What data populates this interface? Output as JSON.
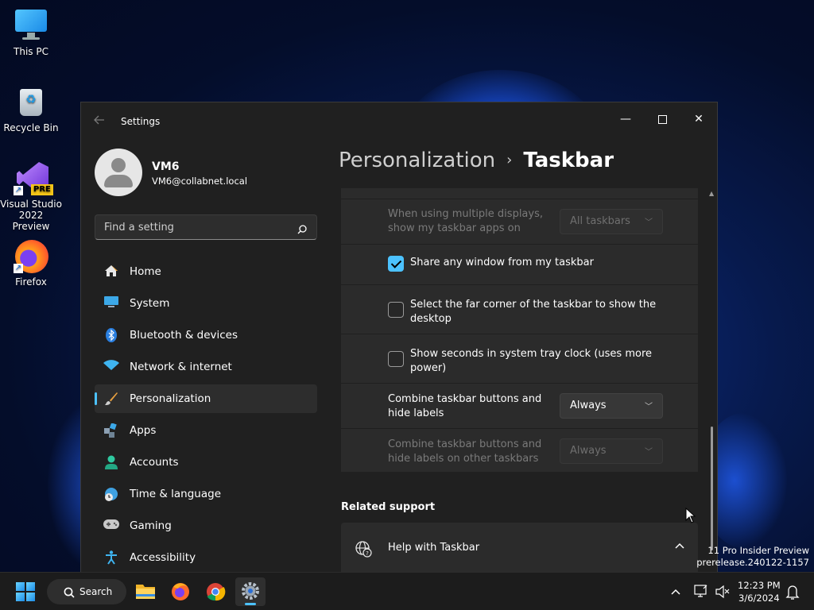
{
  "desktop": {
    "icons": [
      {
        "label": "This PC",
        "icon": "computer-monitor-icon"
      },
      {
        "label": "Recycle Bin",
        "icon": "recycle-bin-icon"
      },
      {
        "label_line1": "Visual Studio",
        "label_line2": "2022 Preview",
        "badge": "PRE",
        "icon": "visual-studio-icon"
      },
      {
        "label": "Firefox",
        "icon": "firefox-icon"
      }
    ],
    "watermark": {
      "line1": "11 Pro Insider Preview",
      "line2": "prerelease.240122-1157"
    }
  },
  "window": {
    "title": "Settings",
    "controls": {
      "minimize": "—",
      "maximize": "☐",
      "close": "✕"
    },
    "profile": {
      "name": "VM6",
      "email": "VM6@collabnet.local"
    },
    "search": {
      "placeholder": "Find a setting"
    },
    "nav": [
      {
        "label": "Home",
        "icon": "home-icon",
        "active": false
      },
      {
        "label": "System",
        "icon": "system-display-icon",
        "active": false
      },
      {
        "label": "Bluetooth & devices",
        "icon": "bluetooth-icon",
        "active": false
      },
      {
        "label": "Network & internet",
        "icon": "wifi-icon",
        "active": false
      },
      {
        "label": "Personalization",
        "icon": "paintbrush-icon",
        "active": true
      },
      {
        "label": "Apps",
        "icon": "apps-icon",
        "active": false
      },
      {
        "label": "Accounts",
        "icon": "person-icon",
        "active": false
      },
      {
        "label": "Time & language",
        "icon": "globe-clock-icon",
        "active": false
      },
      {
        "label": "Gaming",
        "icon": "gamepad-icon",
        "active": false
      },
      {
        "label": "Accessibility",
        "icon": "accessibility-icon",
        "active": false
      }
    ],
    "breadcrumb": {
      "parent": "Personalization",
      "separator": "›",
      "current": "Taskbar"
    },
    "settings": {
      "multi_display": {
        "label_line1": "When using multiple displays,",
        "label_line2": "show my taskbar apps on",
        "value": "All taskbars",
        "disabled": true
      },
      "share_window": {
        "label": "Share any window from my taskbar",
        "checked": true
      },
      "far_corner": {
        "label_line1": "Select the far corner of the taskbar to show the",
        "label_line2": "desktop",
        "checked": false
      },
      "show_seconds": {
        "label_line1": "Show seconds in system tray clock (uses more",
        "label_line2": "power)",
        "checked": false
      },
      "combine_main": {
        "label_line1": "Combine taskbar buttons and",
        "label_line2": "hide labels",
        "value": "Always",
        "disabled": false
      },
      "combine_other": {
        "label_line1": "Combine taskbar buttons and",
        "label_line2": "hide labels on other taskbars",
        "value": "Always",
        "disabled": true
      }
    },
    "related_support": {
      "heading": "Related support",
      "help_label": "Help with Taskbar",
      "expanded": true
    }
  },
  "taskbar": {
    "search_label": "Search",
    "apps": [
      "file-explorer-icon",
      "firefox-icon",
      "chrome-icon",
      "settings-icon"
    ],
    "active_app": "settings-icon",
    "clock": {
      "time": "12:23 PM",
      "date": "3/6/2024"
    }
  },
  "colors": {
    "accent": "#4cc2ff",
    "window_bg": "#202020",
    "card_bg": "#2b2b2b",
    "taskbar_bg": "#1c1c1c"
  }
}
